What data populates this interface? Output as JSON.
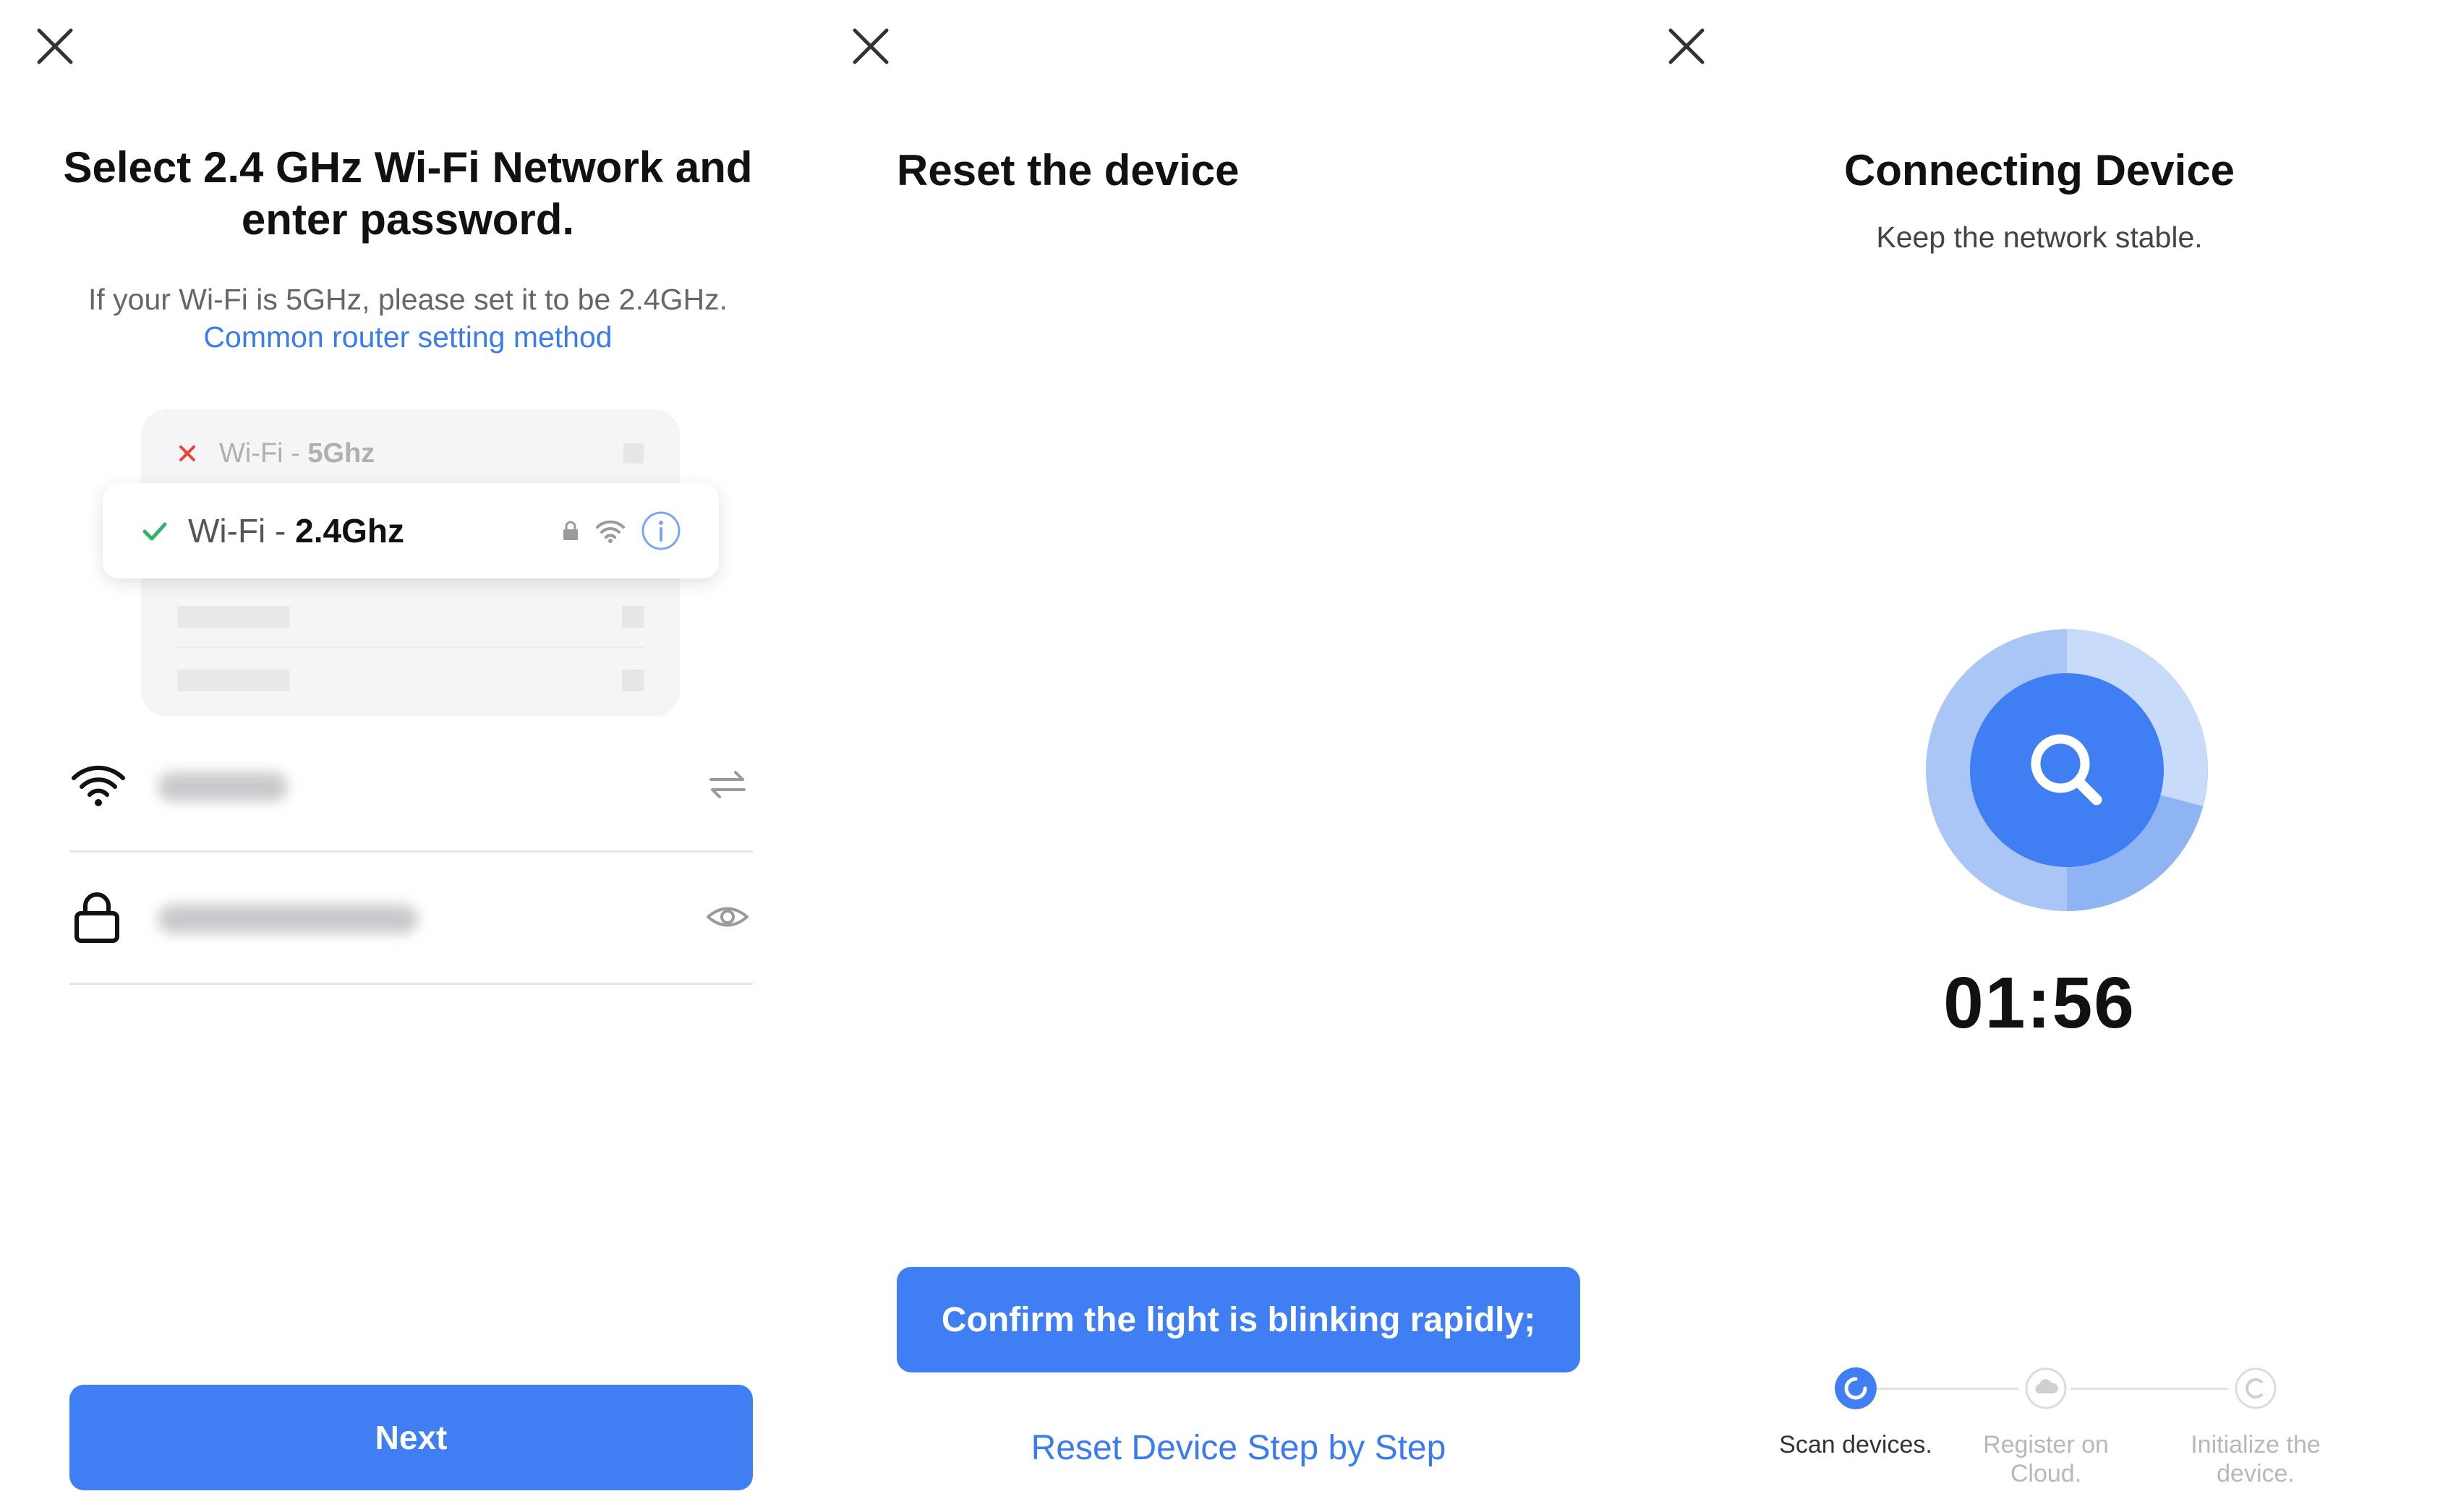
{
  "colors": {
    "accent": "#3f7ef3",
    "link": "#3a7bf0",
    "success": "#2fb36a",
    "error": "#e8443a"
  },
  "panel1": {
    "close_icon": "close-icon",
    "title": "Select 2.4 GHz Wi-Fi Network and enter password.",
    "subtitle_text": "If your Wi-Fi is 5GHz, please set it to be 2.4GHz.",
    "subtitle_link": "Common router setting method",
    "wifi_5g": {
      "prefix": "Wi-Fi - ",
      "band": "5Ghz",
      "status_icon": "cross-icon"
    },
    "wifi_24g": {
      "prefix": "Wi-Fi - ",
      "band": "2.4Ghz",
      "status_icon": "check-icon",
      "icons": [
        "lock-icon",
        "wifi-icon",
        "info-icon"
      ]
    },
    "ssid_field": {
      "lead_icon": "wifi-icon",
      "trail_icon": "switch-arrows-icon"
    },
    "password_field": {
      "lead_icon": "lock-icon",
      "trail_icon": "eye-icon"
    },
    "next_label": "Next"
  },
  "panel2": {
    "close_icon": "close-icon",
    "title": "Reset the device",
    "confirm_label": "Confirm the light is blinking rapidly;",
    "step_link": "Reset Device Step by Step"
  },
  "panel3": {
    "close_icon": "close-icon",
    "title": "Connecting Device",
    "subtitle": "Keep the network stable.",
    "radar_icon": "search-icon",
    "timer": "01:56",
    "steps": [
      {
        "label": "Scan devices.",
        "state": "active"
      },
      {
        "label": "Register on Cloud.",
        "state": "pending",
        "icon": "cloud-icon"
      },
      {
        "label": "Initialize the device.",
        "state": "pending",
        "icon": "c-icon"
      }
    ]
  }
}
